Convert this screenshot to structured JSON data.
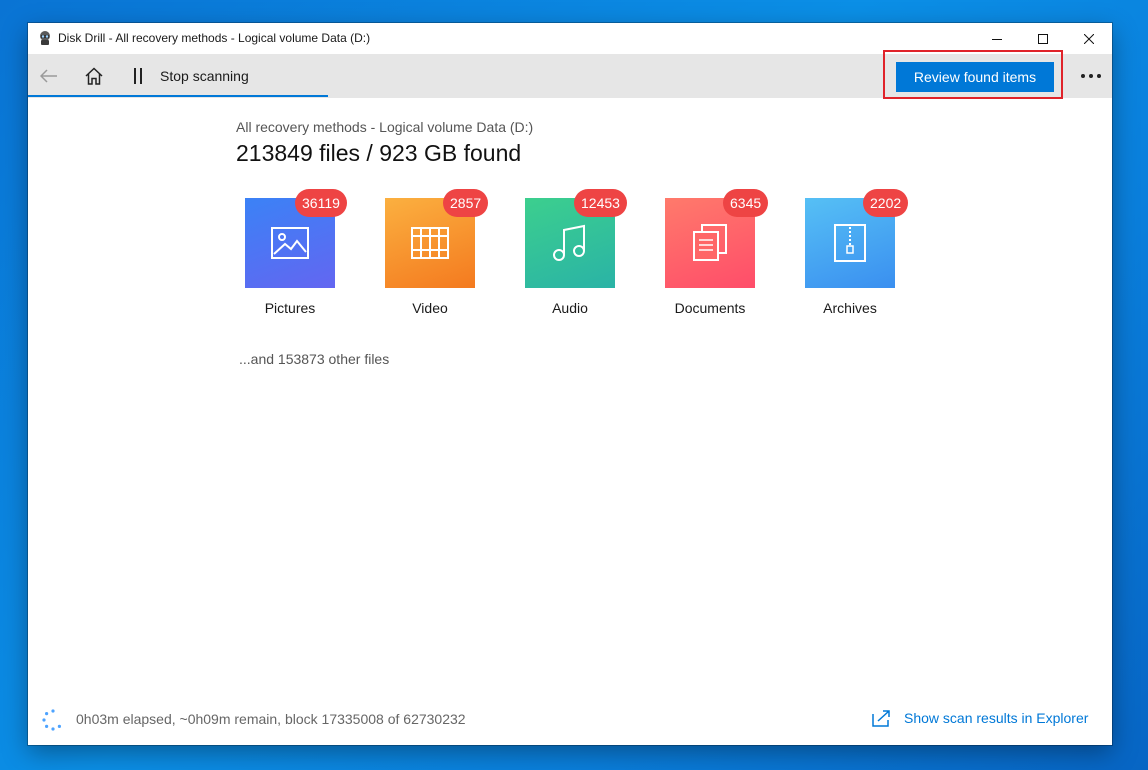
{
  "window": {
    "title": "Disk Drill - All recovery methods - Logical volume Data (D:)"
  },
  "toolbar": {
    "stop_label": "Stop scanning",
    "review_label": "Review found items"
  },
  "main": {
    "subtitle": "All recovery methods - Logical volume Data (D:)",
    "headline": "213849 files / 923 GB found",
    "categories": [
      {
        "label": "Pictures",
        "count": "36119",
        "icon": "image-icon",
        "colors": [
          "#3b82f6",
          "#6366f1"
        ]
      },
      {
        "label": "Video",
        "count": "2857",
        "icon": "film-icon",
        "colors": [
          "#fbb040",
          "#f47a1f"
        ]
      },
      {
        "label": "Audio",
        "count": "12453",
        "icon": "music-icon",
        "colors": [
          "#3ccf8e",
          "#2ab3a6"
        ]
      },
      {
        "label": "Documents",
        "count": "6345",
        "icon": "documents-icon",
        "colors": [
          "#ff7a6b",
          "#ff4d6a"
        ]
      },
      {
        "label": "Archives",
        "count": "2202",
        "icon": "archive-icon",
        "colors": [
          "#56c0f5",
          "#3a8ff0"
        ]
      }
    ],
    "other_files": "...and 153873 other files"
  },
  "status": {
    "text": "0h03m elapsed, ~0h09m remain, block 17335008 of 62730232",
    "explorer_link": "Show scan results in Explorer"
  },
  "colors": {
    "accent": "#0078d7",
    "badge": "#ee4444",
    "highlight_border": "#e0232a"
  }
}
